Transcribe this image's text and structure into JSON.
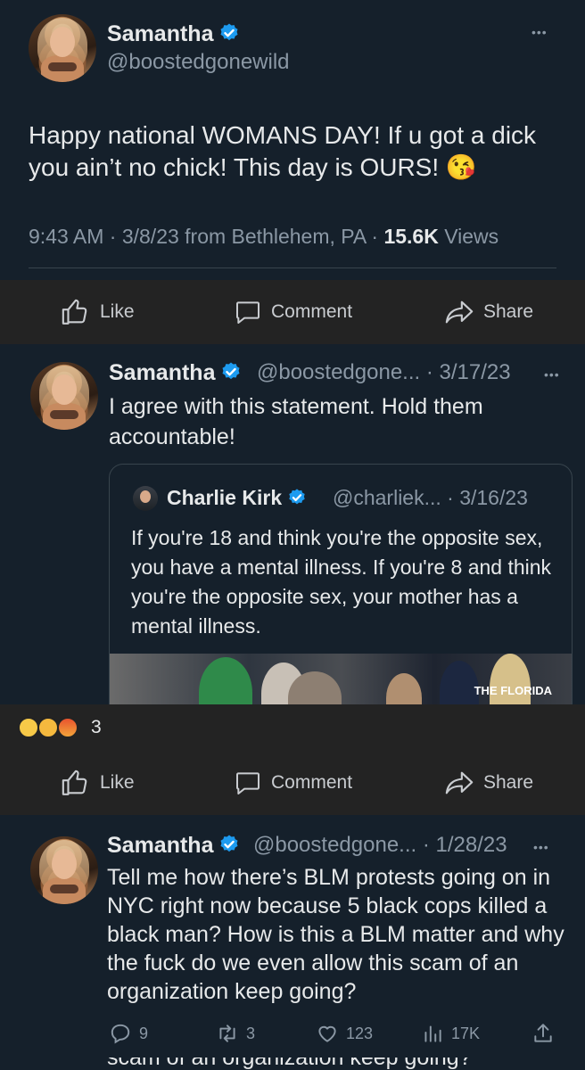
{
  "tweet1": {
    "name": "Samantha",
    "handle": "@boostedgonewild",
    "text": "Happy national WOMANS DAY! If u got a dick you ain’t no chick! This day is OURS! 😘",
    "meta_prefix": "9:43 AM · 3/8/23 from Bethlehem, PA · ",
    "views_count": "15.6K",
    "views_label": " Views",
    "more": "•••"
  },
  "actions": {
    "like": "Like",
    "comment": "Comment",
    "share": "Share"
  },
  "tweet2": {
    "name": "Samantha",
    "handle_date": "@boostedgone... · 3/17/23",
    "text_line1": "I agree with this statement. Hold them",
    "text_line2": "accountable!",
    "more": "•••"
  },
  "quote": {
    "name": "Charlie Kirk",
    "handle_date": "@charliek... · 3/16/23",
    "text": "If you're 18 and think you're the opposite sex, you have a mental illness. If you're 8 and think you're the opposite sex, your mother has a mental illness.",
    "image_logo": "THE FLORIDA"
  },
  "reactions": {
    "emojis": [
      "😮",
      "😢",
      "😡"
    ],
    "count": "3"
  },
  "tweet3": {
    "name": "Samantha",
    "handle_date": "@boostedgone... · 1/28/23",
    "text": "Tell me how there’s BLM protests going on in NYC right now because 5 black cops killed a black man? How is this a BLM matter and why the fuck do we even allow this scam of an organization keep going?",
    "more": "•••",
    "stats": {
      "replies": "9",
      "retweets": "3",
      "likes": "123",
      "views": "17K"
    }
  },
  "cutoff_text": "scam of an organization keep going?",
  "colors": {
    "background": "#15202b",
    "bar": "#232323",
    "verified": "#1d9bf0",
    "muted": "#8b98a5"
  }
}
